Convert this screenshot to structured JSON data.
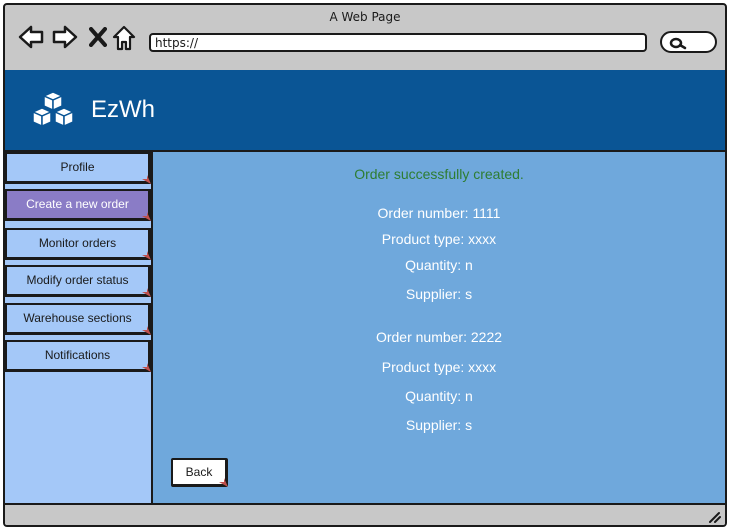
{
  "browser": {
    "title": "A Web Page",
    "url": "https://",
    "icons": [
      "back-arrow-icon",
      "forward-arrow-icon",
      "close-icon",
      "home-icon",
      "search-icon"
    ]
  },
  "app": {
    "name": "EzWh",
    "logo_icon": "cubes-icon",
    "header_color": "#0a5595"
  },
  "sidebar": {
    "items": [
      {
        "label": "Profile",
        "active": false
      },
      {
        "label": "Create a new order",
        "active": true
      },
      {
        "label": "Monitor orders",
        "active": false
      },
      {
        "label": "Modify order status",
        "active": false
      },
      {
        "label": "Warehouse sections",
        "active": false
      },
      {
        "label": "Notifications",
        "active": false
      }
    ]
  },
  "main": {
    "success_message": "Order successfully created.",
    "orders": [
      {
        "order_number": "Order number: 1111",
        "product_type": "Product type: xxxx",
        "quantity": "Quantity: n",
        "supplier": "Supplier: s"
      },
      {
        "order_number": "Order number: 2222",
        "product_type": "Product type: xxxx",
        "quantity": "Quantity: n",
        "supplier": "Supplier: s"
      }
    ],
    "back_label": "Back"
  },
  "colors": {
    "sidebar_bg": "#a4c8f8",
    "active_item": "#8a7cc6",
    "content_bg": "#6fa8dc",
    "success_text": "#2e7d32"
  }
}
